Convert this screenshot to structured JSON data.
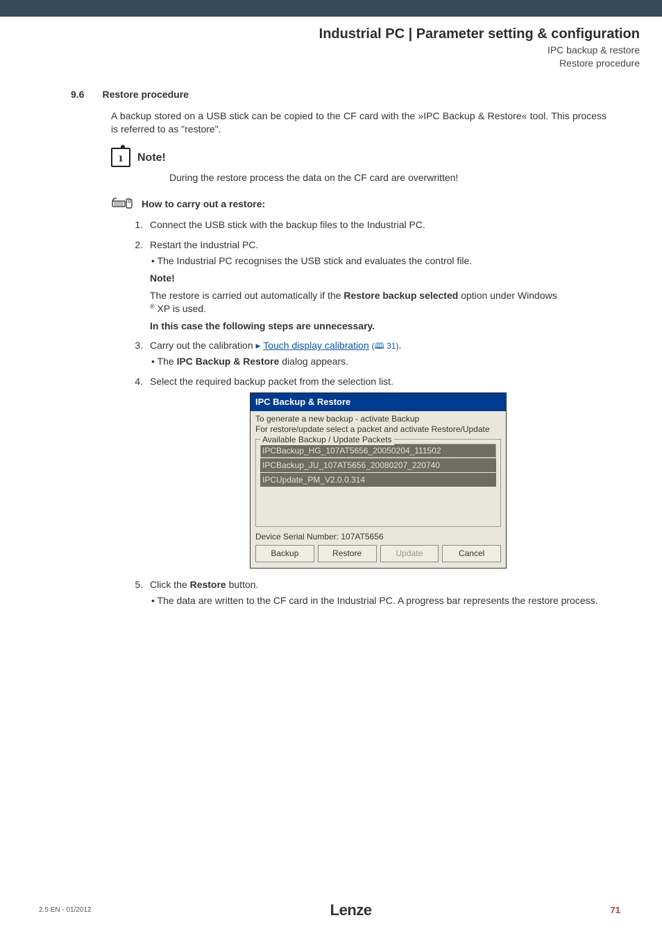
{
  "header": {
    "title": "Industrial PC | Parameter setting & configuration",
    "sub1": "IPC backup & restore",
    "sub2": "Restore procedure"
  },
  "section": {
    "num": "9.6",
    "title": "Restore procedure"
  },
  "intro": "A backup stored on a USB stick can be copied to the CF card with the »IPC Backup & Restore« tool. This process is referred to as \"restore\".",
  "note": {
    "label": "Note!",
    "body": "During the restore process the data on the CF card are overwritten!"
  },
  "howto": {
    "label": "How to carry out a restore:"
  },
  "steps": {
    "s1": "Connect the USB stick with the backup files to the Industrial PC.",
    "s2": "Restart the Industrial PC.",
    "s2_sub": "The Industrial PC recognises the USB stick and evaluates the control file.",
    "s2_note_label": "Note!",
    "s2_note_a": "The restore is carried out automatically if the ",
    "s2_note_bold": "Restore backup selected",
    "s2_note_b": " option under Windows",
    "s2_note_sup": "®",
    "s2_note_c": " XP is used.",
    "s2_unnec": "In this case the following steps are unnecessary.",
    "s3_a": "Carry out the calibration   ",
    "s3_link": "Touch display calibration",
    "s3_ref": "(🕮 31)",
    "s3_dot": ".",
    "s3_sub_a": "The ",
    "s3_sub_bold": "IPC Backup & Restore",
    "s3_sub_b": " dialog appears.",
    "s4": "Select the required backup packet from the selection list.",
    "s5_a": "Click the ",
    "s5_bold": "Restore",
    "s5_b": " button.",
    "s5_sub": "The data are written to the CF card in the Industrial PC. A progress bar represents the restore process."
  },
  "dialog": {
    "title": "IPC Backup & Restore",
    "instr1": "To generate a new backup - activate Backup",
    "instr2": "For restore/update select a packet and activate Restore/Update",
    "group_label": "Available Backup / Update Packets",
    "items": [
      "IPCBackup_HG_107AT5656_20050204_111502",
      "IPCBackup_JU_107AT5656_20080207_220740",
      "IPCUpdate_PM_V2.0.0.314"
    ],
    "serial_label": "Device Serial Number:  ",
    "serial_value": "107AT5656",
    "btn_backup": "Backup",
    "btn_restore": "Restore",
    "btn_update": "Update",
    "btn_cancel": "Cancel"
  },
  "footer": {
    "left": "2.5 EN - 01/2012",
    "center": "Lenze",
    "right": "71"
  }
}
